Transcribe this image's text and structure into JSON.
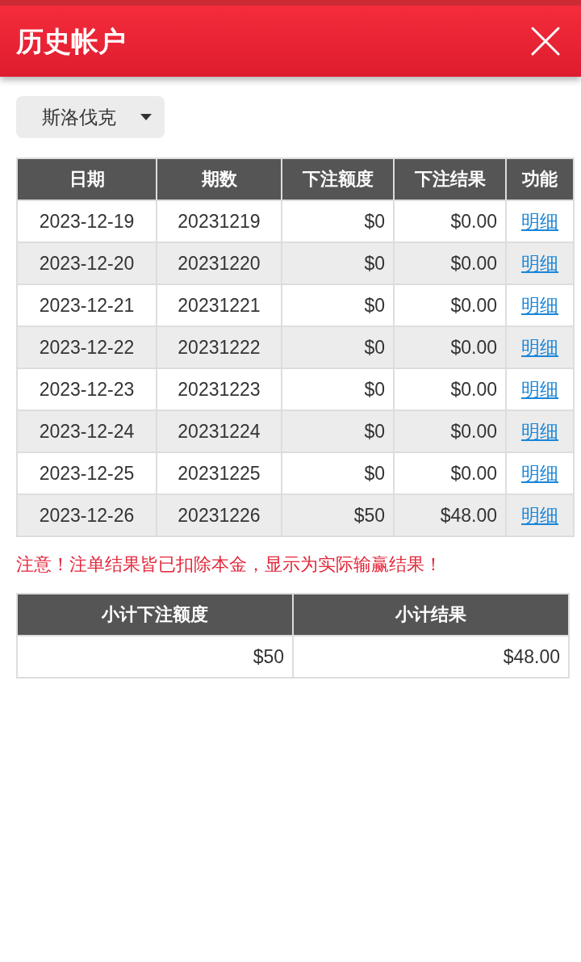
{
  "header": {
    "title": "历史帐户"
  },
  "region_select": {
    "value": "斯洛伐克"
  },
  "history_table": {
    "columns": [
      "日期",
      "期数",
      "下注额度",
      "下注结果",
      "功能"
    ],
    "rows": [
      {
        "date": "2023-12-19",
        "issue": "20231219",
        "bet_amount": "$0",
        "bet_result": "$0.00",
        "action": "明细"
      },
      {
        "date": "2023-12-20",
        "issue": "20231220",
        "bet_amount": "$0",
        "bet_result": "$0.00",
        "action": "明细"
      },
      {
        "date": "2023-12-21",
        "issue": "20231221",
        "bet_amount": "$0",
        "bet_result": "$0.00",
        "action": "明细"
      },
      {
        "date": "2023-12-22",
        "issue": "20231222",
        "bet_amount": "$0",
        "bet_result": "$0.00",
        "action": "明细"
      },
      {
        "date": "2023-12-23",
        "issue": "20231223",
        "bet_amount": "$0",
        "bet_result": "$0.00",
        "action": "明细"
      },
      {
        "date": "2023-12-24",
        "issue": "20231224",
        "bet_amount": "$0",
        "bet_result": "$0.00",
        "action": "明细"
      },
      {
        "date": "2023-12-25",
        "issue": "20231225",
        "bet_amount": "$0",
        "bet_result": "$0.00",
        "action": "明细"
      },
      {
        "date": "2023-12-26",
        "issue": "20231226",
        "bet_amount": "$50",
        "bet_result": "$48.00",
        "action": "明细"
      }
    ]
  },
  "notice": "注意！注单结果皆已扣除本金，显示为实际输赢结果！",
  "summary_table": {
    "columns": [
      "小计下注额度",
      "小计结果"
    ],
    "values": [
      "$50",
      "$48.00"
    ]
  }
}
